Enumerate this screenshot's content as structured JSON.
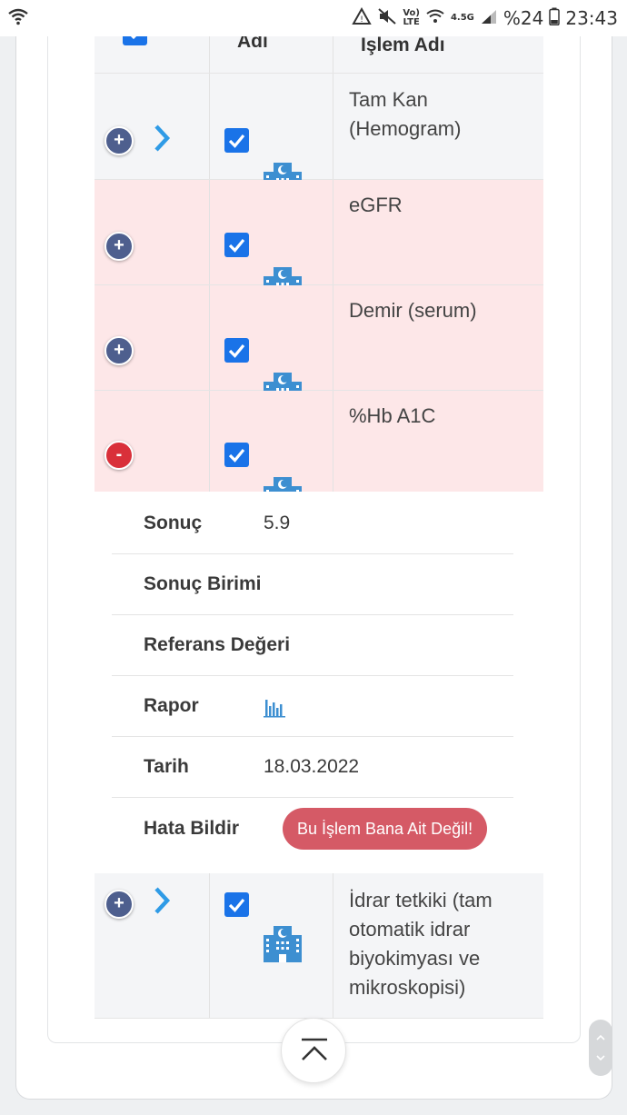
{
  "status_bar": {
    "lte_top": "Vo)",
    "lte_bottom": "LTE",
    "net_type": "4.5G",
    "battery": "%24",
    "time": "23:43"
  },
  "table": {
    "header": {
      "col2": "Adı",
      "col3": "İşlem Adı"
    },
    "rows": [
      {
        "name": "Tam Kan (Hemogram)",
        "expand": "+",
        "has_chevron": true,
        "checked": true,
        "tint": "grey"
      },
      {
        "name": "eGFR",
        "expand": "+",
        "has_chevron": false,
        "checked": true,
        "tint": "pink"
      },
      {
        "name": "Demir (serum)",
        "expand": "+",
        "has_chevron": false,
        "checked": true,
        "tint": "pink"
      },
      {
        "name": "%Hb A1C",
        "expand": "-",
        "has_chevron": false,
        "checked": true,
        "tint": "pink"
      },
      {
        "name": "İdrar tetkiki (tam otomatik idrar biyokimyası ve mikroskopisi)",
        "expand": "+",
        "has_chevron": true,
        "checked": true,
        "tint": "grey"
      }
    ]
  },
  "detail": {
    "result_label": "Sonuç",
    "result_value": "5.9",
    "unit_label": "Sonuç Birimi",
    "unit_value": "",
    "reference_label": "Referans Değeri",
    "reference_value": "",
    "report_label": "Rapor",
    "report_icon": "bar-chart-icon",
    "date_label": "Tarih",
    "date_value": "18.03.2022",
    "error_label": "Hata Bildir",
    "error_button": "Bu İşlem Bana Ait Değil!"
  },
  "colors": {
    "accent_blue": "#1a73e8",
    "icon_blue": "#3d8fd1",
    "chevron_blue": "#2f9be6",
    "danger": "#d9303a",
    "button_red": "#d55a66",
    "row_pink": "#fde7e8",
    "row_grey": "#f4f5f7"
  }
}
